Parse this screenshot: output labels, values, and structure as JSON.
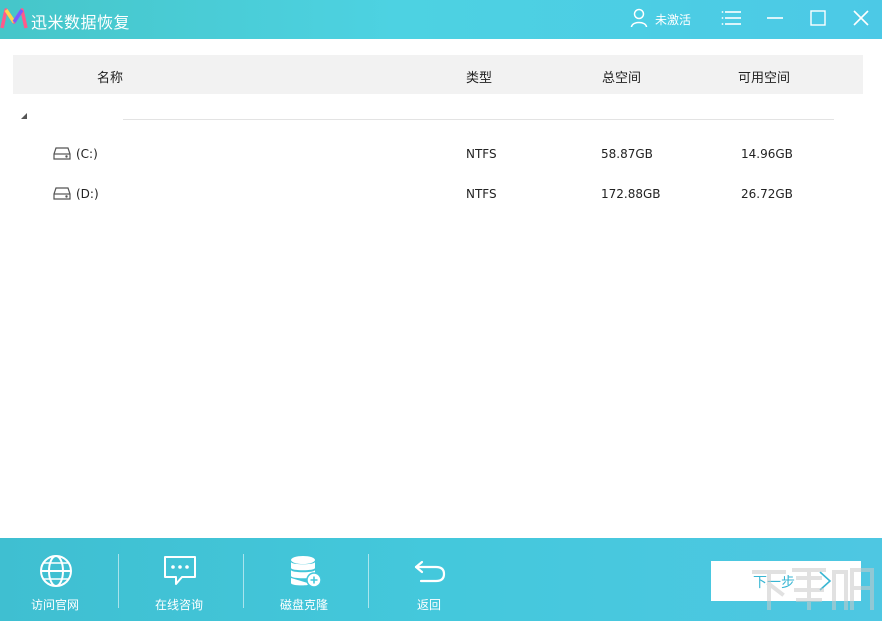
{
  "titlebar": {
    "app_title": "迅米数据恢复",
    "user_status": "未激活"
  },
  "table": {
    "headers": {
      "name": "名称",
      "type": "类型",
      "total": "总空间",
      "free": "可用空间"
    },
    "rows": [
      {
        "name": "(C:)",
        "type": "NTFS",
        "total": "58.87GB",
        "free": "14.96GB"
      },
      {
        "name": "(D:)",
        "type": "NTFS",
        "total": "172.88GB",
        "free": "26.72GB"
      }
    ]
  },
  "toolbar": {
    "visit_site": "访问官网",
    "online_consult": "在线咨询",
    "disk_clone": "磁盘克隆",
    "back": "返回",
    "next": "下一步"
  },
  "colors": {
    "accent_start": "#46c6c9",
    "accent_end": "#4cc9e6",
    "header_bg": "#f2f2f2"
  },
  "icons": [
    "app-logo",
    "user-icon",
    "menu-icon",
    "minimize-icon",
    "maximize-icon",
    "close-icon",
    "drive-icon",
    "globe-icon",
    "chat-icon",
    "database-icon",
    "return-icon",
    "chevron-right-icon"
  ]
}
